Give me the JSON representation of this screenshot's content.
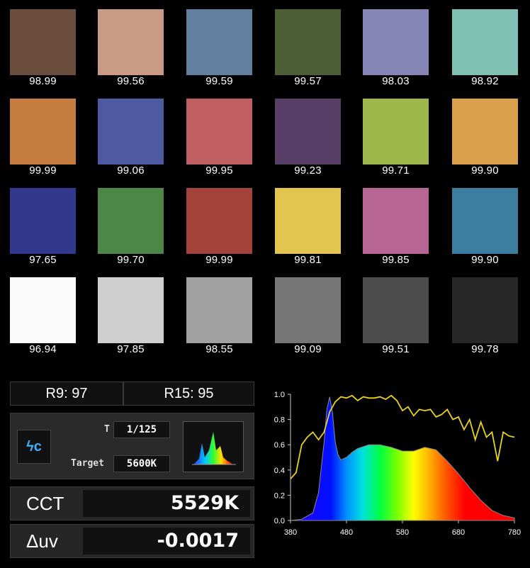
{
  "swatches": [
    {
      "color": "#6b4d3e",
      "value": "98.99"
    },
    {
      "color": "#c99b86",
      "value": "99.56"
    },
    {
      "color": "#637f9f",
      "value": "99.59"
    },
    {
      "color": "#4e5e36",
      "value": "99.57"
    },
    {
      "color": "#8785b5",
      "value": "98.03"
    },
    {
      "color": "#7fc0b2",
      "value": "98.92"
    },
    {
      "color": "#c77c3f",
      "value": "99.99"
    },
    {
      "color": "#4d5aa0",
      "value": "99.06"
    },
    {
      "color": "#bf5f62",
      "value": "99.95"
    },
    {
      "color": "#573e66",
      "value": "99.23"
    },
    {
      "color": "#9fb64b",
      "value": "99.71"
    },
    {
      "color": "#dba04c",
      "value": "99.90"
    },
    {
      "color": "#31388d",
      "value": "97.65"
    },
    {
      "color": "#4c8748",
      "value": "99.70"
    },
    {
      "color": "#a3423b",
      "value": "99.99"
    },
    {
      "color": "#e3c44f",
      "value": "99.81"
    },
    {
      "color": "#b66595",
      "value": "99.85"
    },
    {
      "color": "#3d7ea0",
      "value": "99.90"
    },
    {
      "color": "#fbfbfb",
      "value": "96.94"
    },
    {
      "color": "#cfcfcf",
      "value": "97.85"
    },
    {
      "color": "#a1a1a1",
      "value": "98.55"
    },
    {
      "color": "#767676",
      "value": "99.09"
    },
    {
      "color": "#4c4c4c",
      "value": "99.51"
    },
    {
      "color": "#272727",
      "value": "99.78"
    }
  ],
  "metrics": {
    "r9": "R9: 97",
    "r15": "R15: 95"
  },
  "controls": {
    "mode_icon_text": "ϟc",
    "shutter_label": "T",
    "shutter_value": "1/125",
    "target_label": "Target",
    "target_value": "5600K"
  },
  "readouts": {
    "cct_label": "CCT",
    "cct_value": "5529K",
    "duv_label": "Δuv",
    "duv_value": "-0.0017"
  },
  "chart_data": {
    "type": "line",
    "xlim": [
      380,
      780
    ],
    "ylim": [
      0,
      1.0
    ],
    "xticks": [
      "380",
      "480",
      "580",
      "680",
      "780"
    ],
    "yticks": [
      "0.0",
      "0.2",
      "0.4",
      "0.6",
      "0.8",
      "1.0"
    ],
    "series": [
      {
        "kind": "spd-area",
        "x": [
          380,
          400,
          420,
          430,
          440,
          445,
          450,
          455,
          460,
          465,
          470,
          480,
          490,
          500,
          520,
          540,
          560,
          580,
          600,
          620,
          640,
          660,
          680,
          700,
          720,
          740,
          760,
          780
        ],
        "values": [
          0.0,
          0.01,
          0.06,
          0.22,
          0.62,
          0.88,
          0.98,
          0.85,
          0.62,
          0.52,
          0.48,
          0.5,
          0.54,
          0.57,
          0.6,
          0.6,
          0.58,
          0.55,
          0.55,
          0.58,
          0.56,
          0.47,
          0.37,
          0.26,
          0.16,
          0.08,
          0.04,
          0.02
        ]
      },
      {
        "kind": "yellow-line",
        "color": "#e8d21a",
        "x": [
          380,
          390,
          400,
          410,
          420,
          430,
          440,
          450,
          460,
          470,
          480,
          490,
          500,
          510,
          520,
          530,
          540,
          550,
          560,
          570,
          580,
          590,
          600,
          610,
          620,
          630,
          640,
          650,
          660,
          670,
          680,
          690,
          700,
          710,
          720,
          730,
          740,
          750,
          760,
          770,
          780
        ],
        "values": [
          0.33,
          0.38,
          0.6,
          0.66,
          0.7,
          0.64,
          0.7,
          0.86,
          0.94,
          0.98,
          0.97,
          0.99,
          0.95,
          0.98,
          0.97,
          0.97,
          0.98,
          0.96,
          0.99,
          0.95,
          0.87,
          0.9,
          0.83,
          0.88,
          0.87,
          0.88,
          0.82,
          0.84,
          0.88,
          0.8,
          0.82,
          0.72,
          0.8,
          0.64,
          0.78,
          0.66,
          0.7,
          0.47,
          0.7,
          0.67,
          0.66
        ]
      }
    ]
  }
}
